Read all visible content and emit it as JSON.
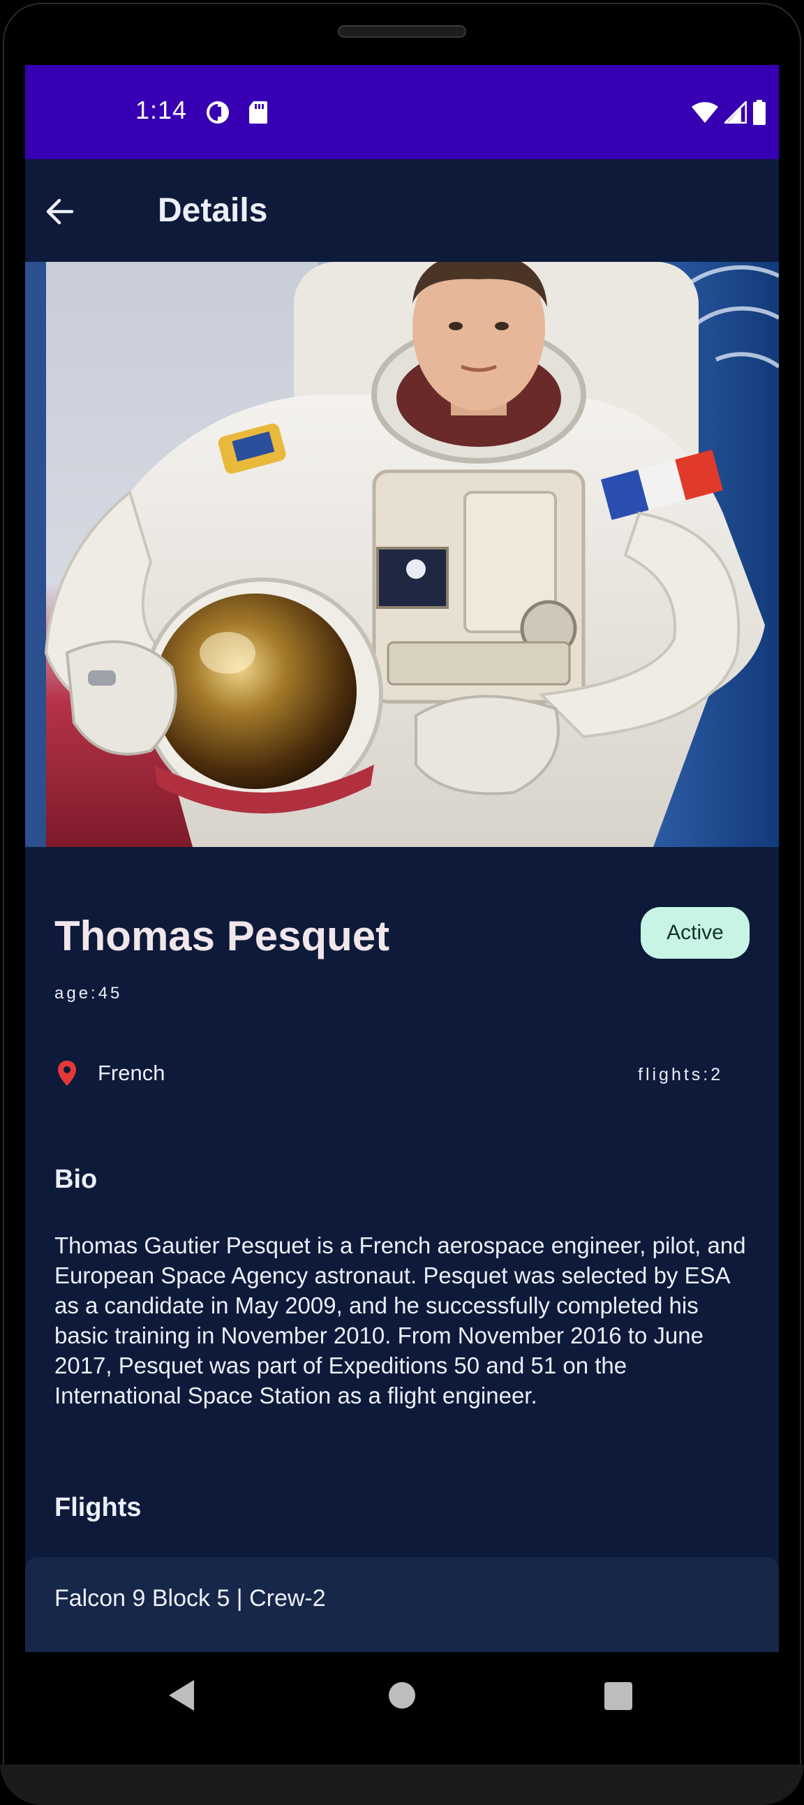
{
  "status_bar": {
    "time": "1:14",
    "icons": [
      "data-saver-icon",
      "sd-card-icon",
      "wifi-icon",
      "cell-signal-icon",
      "battery-icon"
    ],
    "background": "#3700b3"
  },
  "app_bar": {
    "title": "Details",
    "back_icon": "arrow-back-icon"
  },
  "astronaut": {
    "name": "Thomas Pesquet",
    "status": "Active",
    "age_label": "age:45",
    "nationality": "French",
    "flights_label": "flights:2",
    "photo_icon": "astronaut-portrait"
  },
  "bio": {
    "heading": "Bio",
    "text": "Thomas Gautier Pesquet is a French aerospace engineer, pilot, and European Space Agency astronaut. Pesquet was selected by ESA as a candidate in May 2009, and he successfully completed his basic training in November 2010. From November 2016 to June 2017, Pesquet was part of Expeditions 50 and 51 on the International Space Station as a flight engineer."
  },
  "flights": {
    "heading": "Flights",
    "items": [
      {
        "label": "Falcon 9 Block 5 | Crew-2"
      }
    ]
  },
  "navigation": {
    "icons": [
      "nav-back-icon",
      "nav-home-icon",
      "nav-recents-icon"
    ]
  },
  "colors": {
    "background": "#0d1a3a",
    "badge": "#c7f4e4",
    "location_pin": "#e53935",
    "card": "#172749"
  }
}
